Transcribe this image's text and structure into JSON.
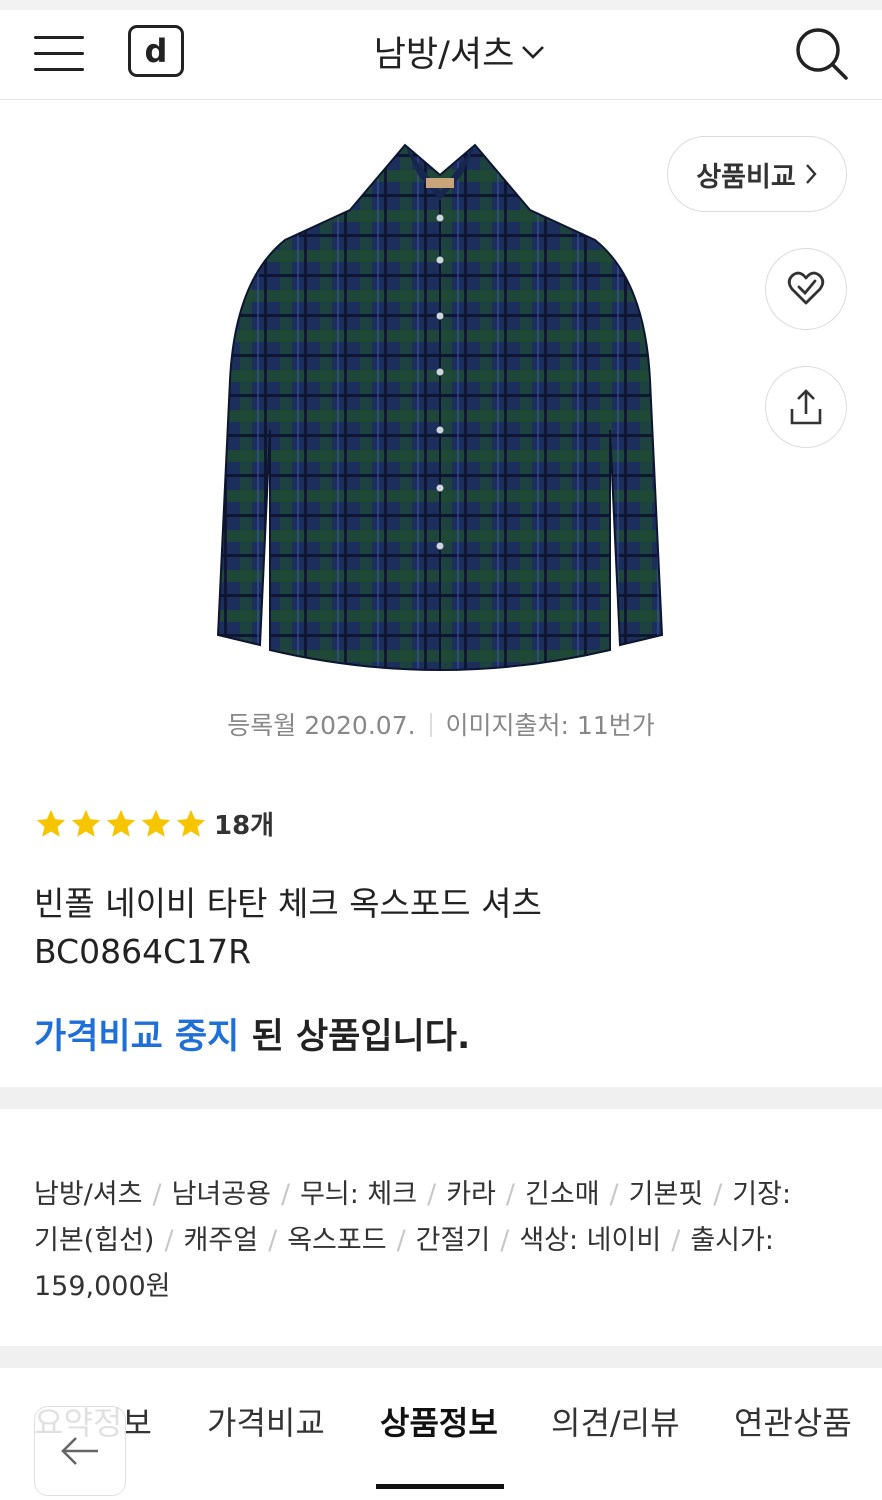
{
  "header": {
    "logo_letter": "d",
    "category_title": "남방/셔츠"
  },
  "product": {
    "compare_label": "상품비교",
    "registered": "등록월 2020.07.",
    "image_source": "이미지출처: 11번가",
    "rating_stars": 5,
    "review_count": "18개",
    "name_line1": "빈폴 네이비 타탄 체크 옥스포드 셔츠",
    "name_line2": "BC0864C17R",
    "status_accent": "가격비교 중지",
    "status_rest": " 된 상품입니다.",
    "colors": {
      "accent": "#1f6fd8",
      "star": "#f7c400"
    }
  },
  "specs": {
    "line1": [
      "남방/셔츠",
      "남녀공용",
      "무늬: 체크",
      "카라",
      "긴소매",
      "기본핏",
      "기장:"
    ],
    "line2": [
      "기본(힙선)",
      "캐주얼",
      "옥스포드",
      "간절기",
      "색상: 네이비",
      "출시가:"
    ],
    "line3": "159,000원"
  },
  "tabs": [
    {
      "label": "요약정보"
    },
    {
      "label": "가격비교"
    },
    {
      "label": "상품정보",
      "active": true
    },
    {
      "label": "의견/리뷰"
    },
    {
      "label": "연관상품"
    }
  ],
  "icons": {
    "menu": "hamburger-icon",
    "search": "search-icon",
    "wishlist": "heart-check-icon",
    "share": "share-icon",
    "back": "arrow-left-icon"
  }
}
